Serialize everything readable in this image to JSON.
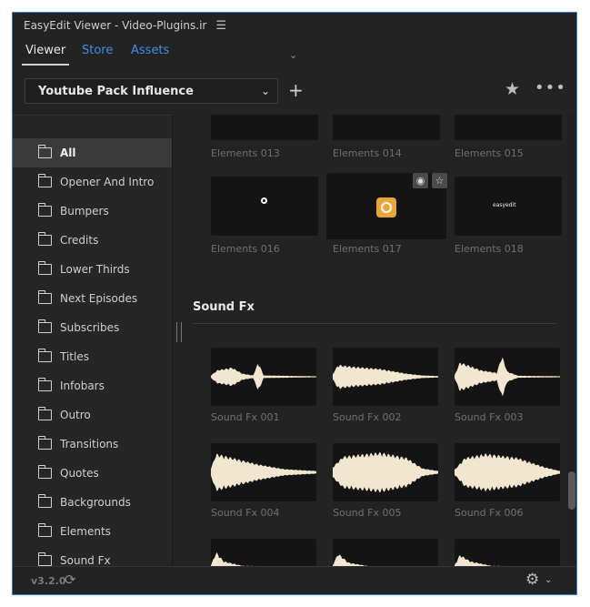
{
  "window": {
    "title": "EasyEdit Viewer - Video-Plugins.ir",
    "menu_icon": "hamburger-icon"
  },
  "tabs": [
    {
      "label": "Viewer",
      "active": true
    },
    {
      "label": "Store",
      "active": false
    },
    {
      "label": "Assets",
      "active": false
    }
  ],
  "tabs_overflow_icon": "chevron-down-icon",
  "toolbar": {
    "pack_selected": "Youtube Pack Influence",
    "add_icon": "plus-icon",
    "favorites_icon": "star-icon",
    "more_icon": "more-icon"
  },
  "sidebar": {
    "items": [
      {
        "label": "All",
        "active": true
      },
      {
        "label": "Opener And Intro"
      },
      {
        "label": "Bumpers"
      },
      {
        "label": "Credits"
      },
      {
        "label": "Lower Thirds"
      },
      {
        "label": "Next Episodes"
      },
      {
        "label": "Subscribes"
      },
      {
        "label": "Titles"
      },
      {
        "label": "Infobars"
      },
      {
        "label": "Outro"
      },
      {
        "label": "Transitions"
      },
      {
        "label": "Quotes"
      },
      {
        "label": "Backgrounds"
      },
      {
        "label": "Elements"
      },
      {
        "label": "Sound Fx"
      }
    ]
  },
  "elements": [
    {
      "label": "Elements 013"
    },
    {
      "label": "Elements 014"
    },
    {
      "label": "Elements 015"
    },
    {
      "label": "Elements 016"
    },
    {
      "label": "Elements 017",
      "hovered": true
    },
    {
      "label": "Elements 018",
      "badge": "easyedit"
    }
  ],
  "sound_section_title": "Sound Fx",
  "sounds": [
    {
      "label": "Sound Fx 001"
    },
    {
      "label": "Sound Fx 002"
    },
    {
      "label": "Sound Fx 003"
    },
    {
      "label": "Sound Fx 004"
    },
    {
      "label": "Sound Fx 005"
    },
    {
      "label": "Sound Fx 006"
    },
    {
      "label": ""
    },
    {
      "label": ""
    },
    {
      "label": ""
    }
  ],
  "hover_actions": {
    "preview_icon": "eye-icon",
    "favorite_icon": "star-icon"
  },
  "footer": {
    "version": "v3.2.0",
    "refresh_icon": "refresh-icon",
    "settings_icon": "gear-icon"
  },
  "colors": {
    "accent": "#3f8de8",
    "waveform": "#f2e6d0",
    "background": "#232323"
  }
}
